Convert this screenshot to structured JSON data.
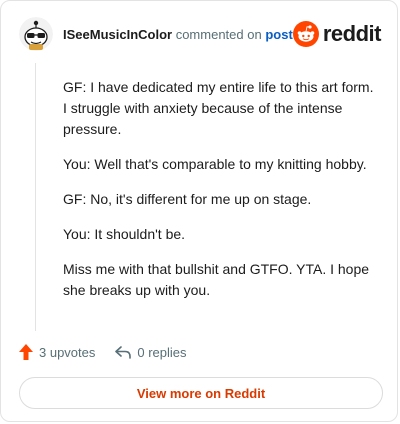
{
  "header": {
    "username": "ISeeMusicInColor",
    "action_text": "commented on",
    "post_link": "post",
    "brand_word": "reddit"
  },
  "comment": {
    "paragraphs": [
      "GF: I have dedicated my entire life to this art form. I struggle with anxiety because of the intense pressure.",
      "You: Well that's comparable to my knitting hobby.",
      "GF: No, it's different for me up on stage.",
      "You: It shouldn't be.",
      "Miss me with that bullshit and GTFO. YTA. I hope she breaks up with you."
    ]
  },
  "actions": {
    "upvotes_label": "3 upvotes",
    "replies_label": "0 replies"
  },
  "footer": {
    "view_more_label": "View more on Reddit"
  },
  "colors": {
    "brand_orange": "#ff4500",
    "link_blue": "#0a5ec2",
    "cta_orange": "#d93a00",
    "muted_gray": "#576f76"
  },
  "icons": {
    "avatar": "snoo-avatar-with-sunglasses",
    "brand": "reddit-snoo-logo-icon",
    "upvote": "upvote-arrow-icon",
    "reply": "reply-arrow-icon"
  }
}
